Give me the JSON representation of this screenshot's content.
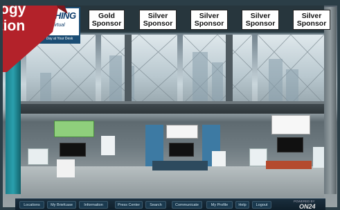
{
  "ribbon": {
    "line1": "ogy",
    "line2": "ation",
    "color": "#b3222a"
  },
  "logo": {
    "title": "USHING",
    "subtitle": "Virtual",
    "band": "Day at Your Desk"
  },
  "sponsors": [
    {
      "line1": "Gold",
      "line2": "Sponsor"
    },
    {
      "line1": "Silver",
      "line2": "Sponsor"
    },
    {
      "line1": "Silver",
      "line2": "Sponsor"
    },
    {
      "line1": "Silver",
      "line2": "Sponsor"
    },
    {
      "line1": "Silver",
      "line2": "Sponsor"
    }
  ],
  "nav": {
    "items": [
      "Locations",
      "My Briefcase",
      "Information",
      "Press Center",
      "Search",
      "Communicate",
      "My Profile",
      "Help",
      "Logout"
    ]
  },
  "footer": {
    "powered_label": "POWERED BY",
    "powered_name": "ON24"
  },
  "colors": {
    "accent_teal": "#2aa0ad",
    "nav_bg": "#0f1f2a"
  }
}
